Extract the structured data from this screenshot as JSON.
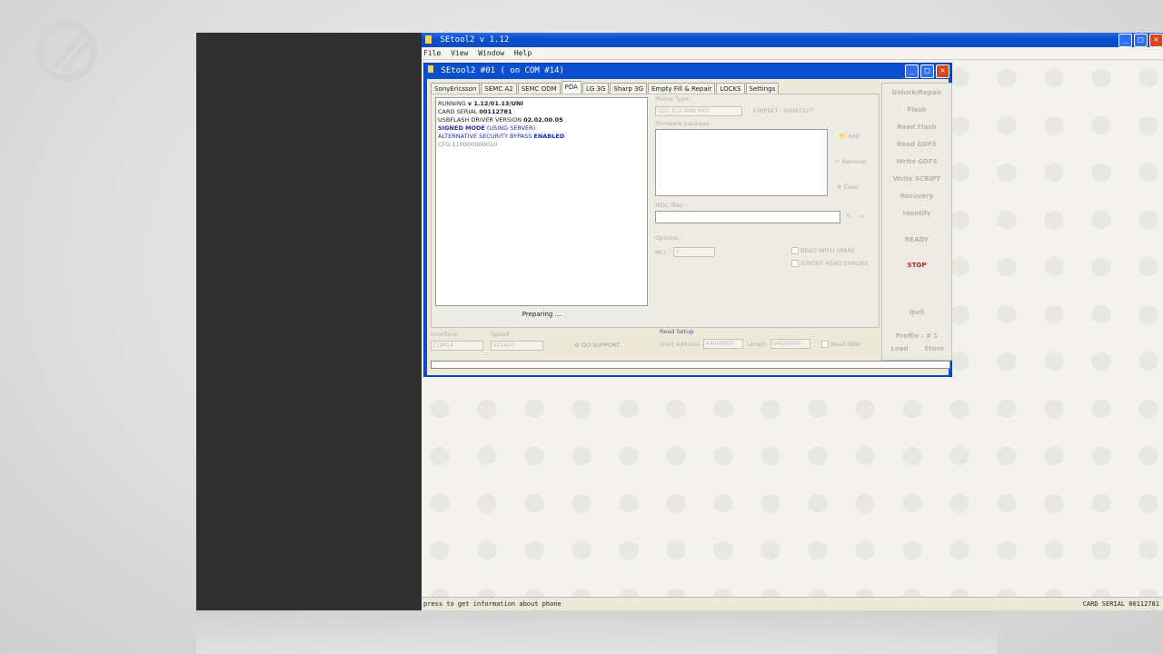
{
  "app": {
    "title": "SEtool2 v 1.12",
    "menu": [
      "File",
      "View",
      "Window",
      "Help"
    ],
    "status_left": "press to get information about phone",
    "status_right": "CARD SERIAL  00112781"
  },
  "child": {
    "title": "SEtool2 #01  ( on COM #14)",
    "tabs": [
      "SonyEricsson",
      "SEMC A2",
      "SEMC ODM",
      "PDA",
      "LG 3G",
      "Sharp 3G",
      "Empty Fill & Repair",
      "LOCKS",
      "Settings"
    ],
    "active_tab": "PDA"
  },
  "log": {
    "line1_a": "RUNNING ",
    "line1_b": "v 1.12/01.13/UNI",
    "line2_a": "CARD SERIAL ",
    "line2_b": "00112781",
    "line3_a": "USBFLASH DRIVER VERSION ",
    "line3_b": "02.02.00.05",
    "line4_a": "SIGNED MODE",
    "line4_b": " (USING SERVER)",
    "line5_a": "ALTERNATIVE SECURITY BYPASS ",
    "line5_b": "ENABLED",
    "line6": "CFG:110000000010",
    "progress": "Preparing ..."
  },
  "form": {
    "phone_type_label": "Phone Type :",
    "phone_type_value": "U20_X10 MINI PRO",
    "chipset": "CHIPSET : MSM7227",
    "firmware_label": "Firmware package:",
    "add": "Add",
    "remove": "Remove",
    "clear": "Clear",
    "mdc_label": "MDC files :",
    "options_label": "Options :",
    "mci_label": "MCI :",
    "mci_value": "0",
    "read_with_spare": "READ WITH SPARE",
    "ignore_read_errors": "IGNORE READ ERRORS"
  },
  "side": {
    "buttons": [
      "Unlock/Repair",
      "Flash",
      "Read Flash",
      "Read GDFS",
      "Write GDFS",
      "Write SCRIPT",
      "Recovery",
      "Identify"
    ],
    "ready": "READY",
    "stop": "STOP",
    "quit": "Quit",
    "profile": "Profile : # 1",
    "load": "Load",
    "store": "Store"
  },
  "bottom": {
    "interface_label": "Interface :",
    "interface_value": "COM14",
    "speed_label": "Speed :",
    "speed_value": "921600",
    "go_support": "GO SUPPORT",
    "read_setup": "Read Setup",
    "start_address_label": "Start Address",
    "start_address_value": "44000000",
    "length_label": "Length",
    "length_value": "00020000",
    "read_sbw": "Read SBW"
  },
  "colors": {
    "title_blue": "#0a4fd0",
    "stop_red": "#d21e1e",
    "log_blue": "#1e2fb8"
  }
}
